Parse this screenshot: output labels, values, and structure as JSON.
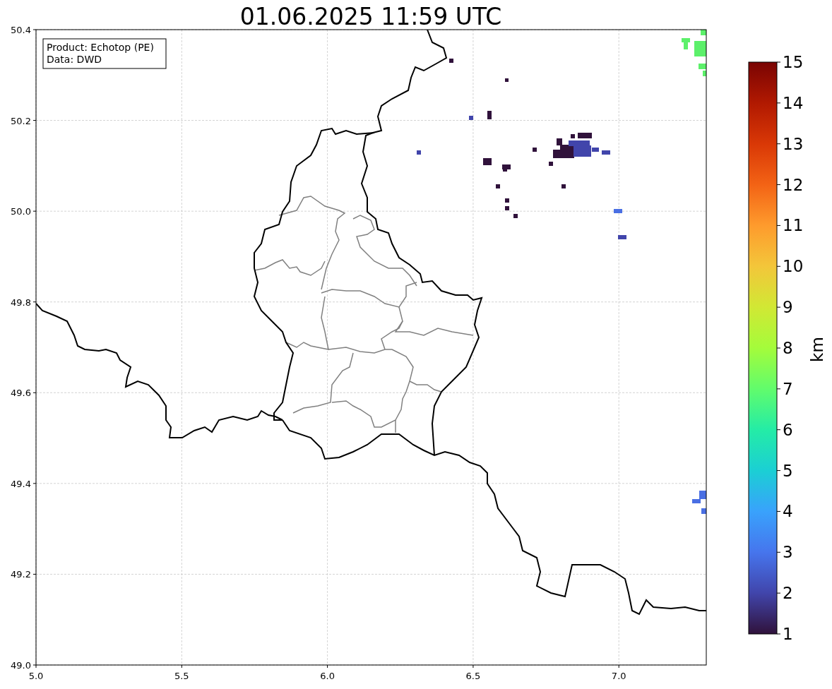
{
  "title": "01.06.2025 11:59 UTC",
  "legend": [
    "Product: Echotop (PE)",
    "Data: DWD"
  ],
  "x_axis": {
    "ticks": [
      "5.0",
      "5.5",
      "6.0",
      "6.5",
      "7.0"
    ]
  },
  "y_axis": {
    "ticks": [
      "50.4",
      "50.2",
      "50.0",
      "49.8",
      "49.6",
      "49.4",
      "49.2",
      "49.0"
    ]
  },
  "colorbar": {
    "label": "km",
    "ticks": [
      "15",
      "14",
      "13",
      "12",
      "11",
      "10",
      "9",
      "8",
      "7",
      "6",
      "5",
      "4",
      "3",
      "2",
      "1"
    ]
  }
}
